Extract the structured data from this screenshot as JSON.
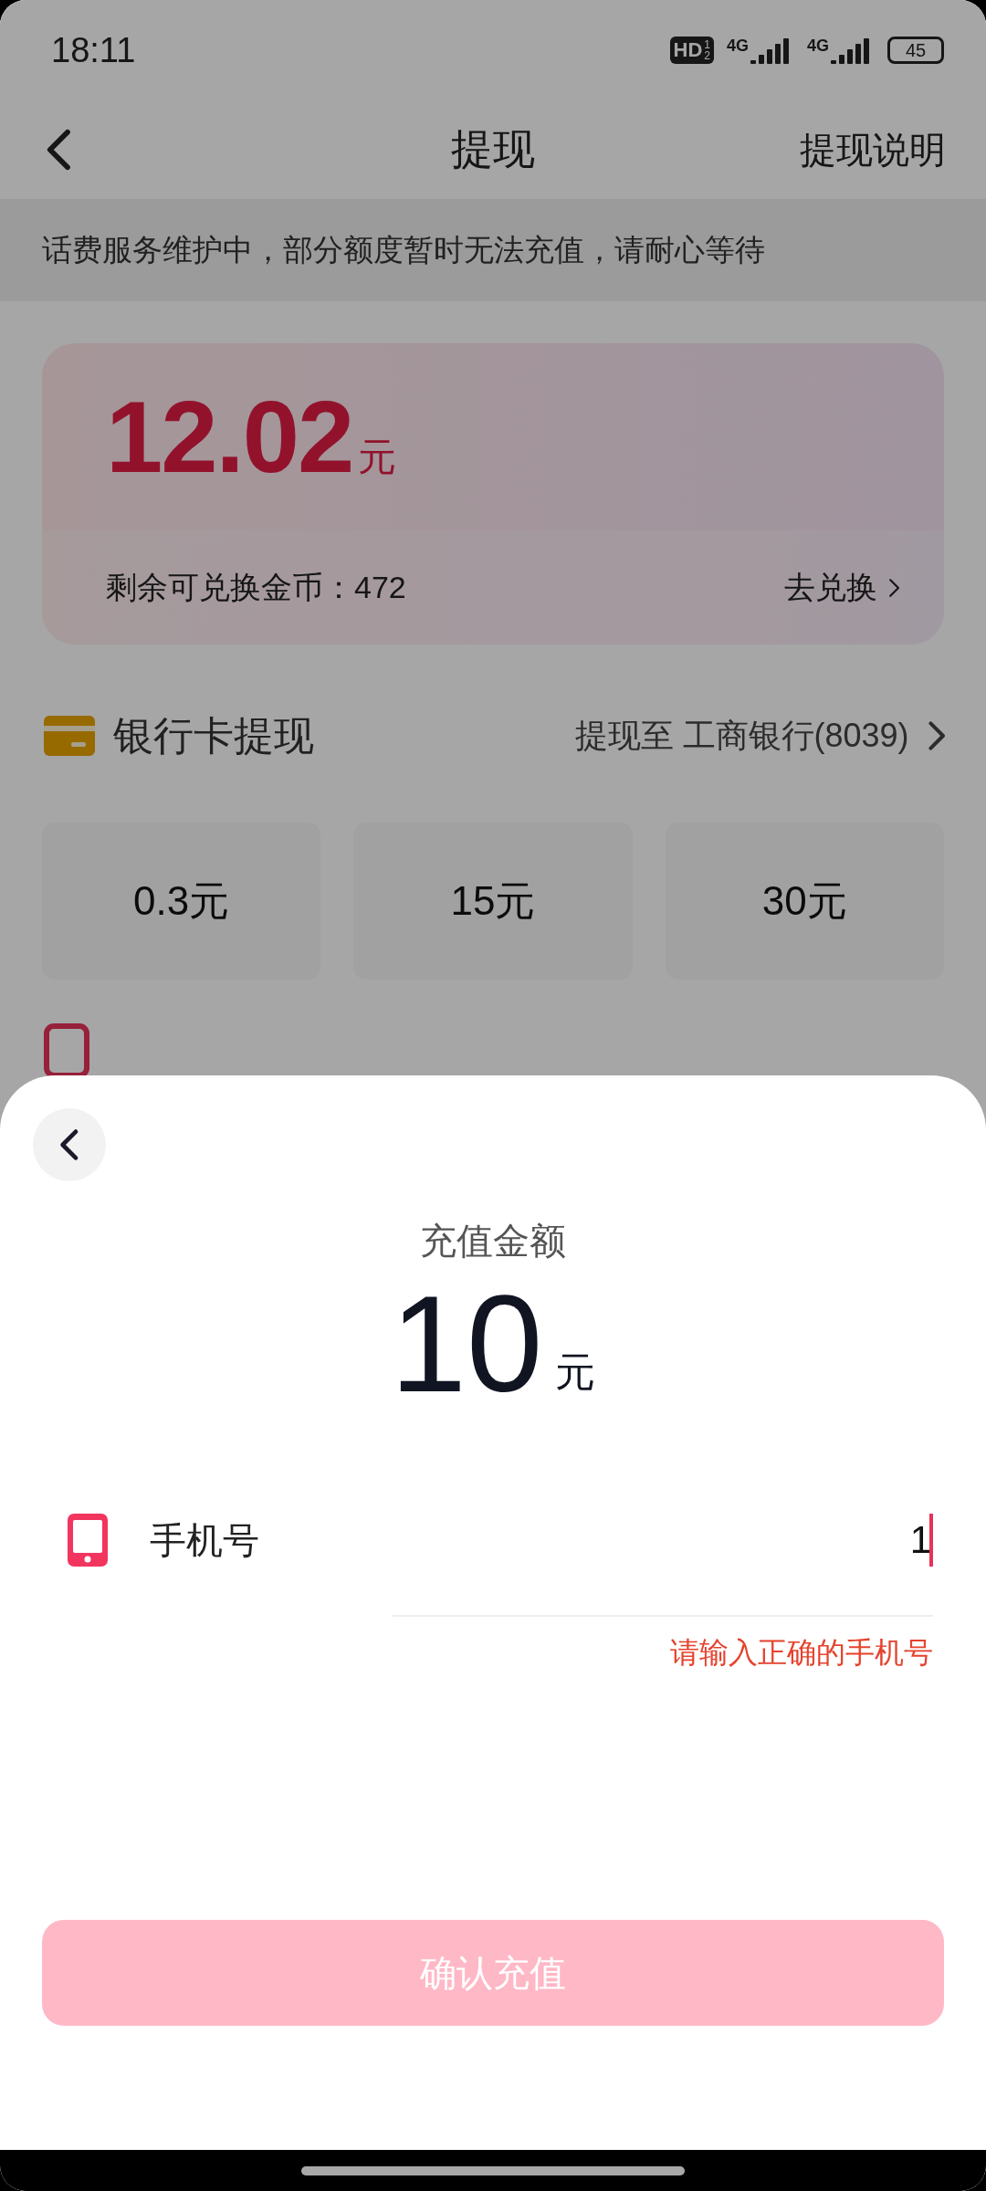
{
  "status_bar": {
    "time": "18:11",
    "hd_badge": "HD",
    "sim_slots": [
      "1",
      "2"
    ],
    "networks": [
      "4G",
      "4G"
    ],
    "battery": "45"
  },
  "nav_bar": {
    "title": "提现",
    "action": "提现说明"
  },
  "notice": "话费服务维护中，部分额度暂时无法充值，请耐心等待",
  "balance_card": {
    "amount": "12.02",
    "unit": "元",
    "coins": "剩余可兑换金币：472",
    "exchange_link": "去兑换"
  },
  "bank_withdraw": {
    "title": "银行卡提现",
    "target": "提现至 工商银行(8039)",
    "amounts": [
      "0.3元",
      "15元",
      "30元"
    ]
  },
  "recharge_sheet": {
    "amount_label": "充值金额",
    "amount": "10",
    "unit": "元",
    "phone_label": "手机号",
    "phone_value": "1",
    "error": "请输入正确的手机号",
    "confirm": {
      "label": "确认充值",
      "disabled": true
    }
  }
}
